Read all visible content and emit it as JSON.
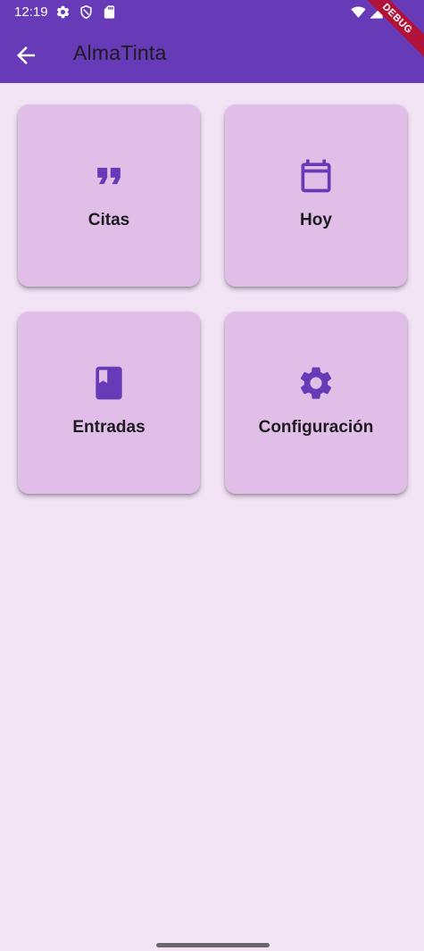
{
  "status_bar": {
    "time": "12:19",
    "icons": [
      "settings-icon",
      "shield-icon",
      "sd-card-icon",
      "wifi-icon",
      "signal-icon",
      "battery-icon"
    ]
  },
  "app_bar": {
    "title": "AlmaTinta",
    "back_icon": "arrow-back-icon"
  },
  "debug_banner": {
    "label": "DEBUG"
  },
  "grid": {
    "items": [
      {
        "label": "Citas",
        "icon": "format-quote-icon"
      },
      {
        "label": "Hoy",
        "icon": "calendar-icon"
      },
      {
        "label": "Entradas",
        "icon": "book-icon"
      },
      {
        "label": "Configuración",
        "icon": "settings-icon"
      }
    ]
  },
  "colors": {
    "primary": "#673ab7",
    "background": "#f2e4f5",
    "card": "#e1bee7",
    "text": "#1d1b20",
    "debug": "#b0123a"
  }
}
